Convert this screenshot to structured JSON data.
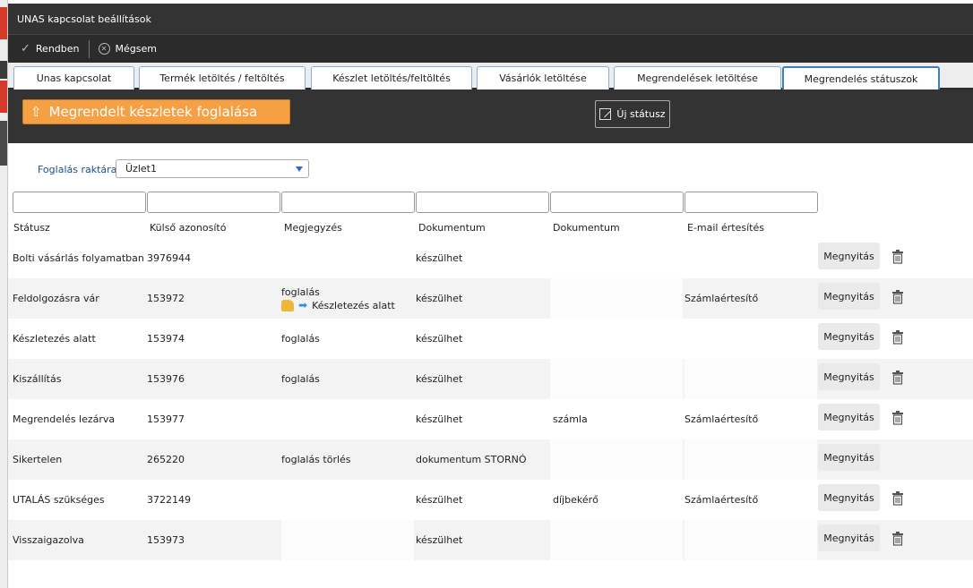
{
  "window": {
    "title": "UNAS kapcsolat beállítások"
  },
  "toolbar": {
    "ok_label": "Rendben",
    "cancel_label": "Mégsem"
  },
  "tabs": [
    {
      "label": "Unas kapcsolat"
    },
    {
      "label": "Termék letöltés / feltöltés"
    },
    {
      "label": "Készlet letöltés/feltöltés"
    },
    {
      "label": "Vásárlók letöltése"
    },
    {
      "label": "Megrendelések letöltése"
    },
    {
      "label": "Megrendelés státuszok"
    }
  ],
  "active_tab": "Megrendelés státuszok",
  "panel": {
    "reserve_button": "Megrendelt készletek foglalása",
    "new_status_button": "Új státusz"
  },
  "filter": {
    "label": "Foglalás raktára: :",
    "selected": "Üzlet1"
  },
  "table": {
    "headers": [
      "Státusz",
      "Külső azonosító",
      "Megjegyzés",
      "Dokumentum",
      "Dokumentum",
      "E-mail értesítés"
    ],
    "open_label": "Megnyitás",
    "rows": [
      {
        "status": "Bolti vásárlás folyamatban",
        "external_id": "3976944",
        "note": "",
        "note2": "",
        "doc1": "készülhet",
        "doc2": "",
        "email": ""
      },
      {
        "status": "Feldolgozásra vár",
        "external_id": "153972",
        "note": "foglalás",
        "note2": "Készletezés alatt",
        "doc1": "készülhet",
        "doc2": "",
        "email": "Számlaértesítő"
      },
      {
        "status": "Készletezés alatt",
        "external_id": "153974",
        "note": "foglalás",
        "note2": "",
        "doc1": "készülhet",
        "doc2": "",
        "email": ""
      },
      {
        "status": "Kiszállítás",
        "external_id": "153976",
        "note": "foglalás",
        "note2": "",
        "doc1": "készülhet",
        "doc2": "",
        "email": ""
      },
      {
        "status": "Megrendelés lezárva",
        "external_id": "153977",
        "note": "",
        "note2": "",
        "doc1": "készülhet",
        "doc2": "számla",
        "email": "Számlaértesítő"
      },
      {
        "status": "Sikertelen",
        "external_id": "265220",
        "note": "foglalás törlés",
        "note2": "",
        "doc1": "dokumentum STORNÓ",
        "doc2": "",
        "email": ""
      },
      {
        "status": "UTALÁS szükséges",
        "external_id": "3722149",
        "note": "",
        "note2": "",
        "doc1": "készülhet",
        "doc2": "díjbekérő",
        "email": "Számlaértesítő"
      },
      {
        "status": "Visszaigazolva",
        "external_id": "153973",
        "note": "",
        "note2": "",
        "doc1": "készülhet",
        "doc2": "",
        "email": ""
      }
    ]
  },
  "colors": {
    "orange": "#f5a043",
    "dark": "#333333",
    "tab_border": "#3f7fc1"
  },
  "icons": [
    "check-icon",
    "close-circle-icon",
    "upload-arrow-icon",
    "edit-icon",
    "dropdown-arrow-icon",
    "hand-icon",
    "arrow-right-icon",
    "trash-icon"
  ]
}
